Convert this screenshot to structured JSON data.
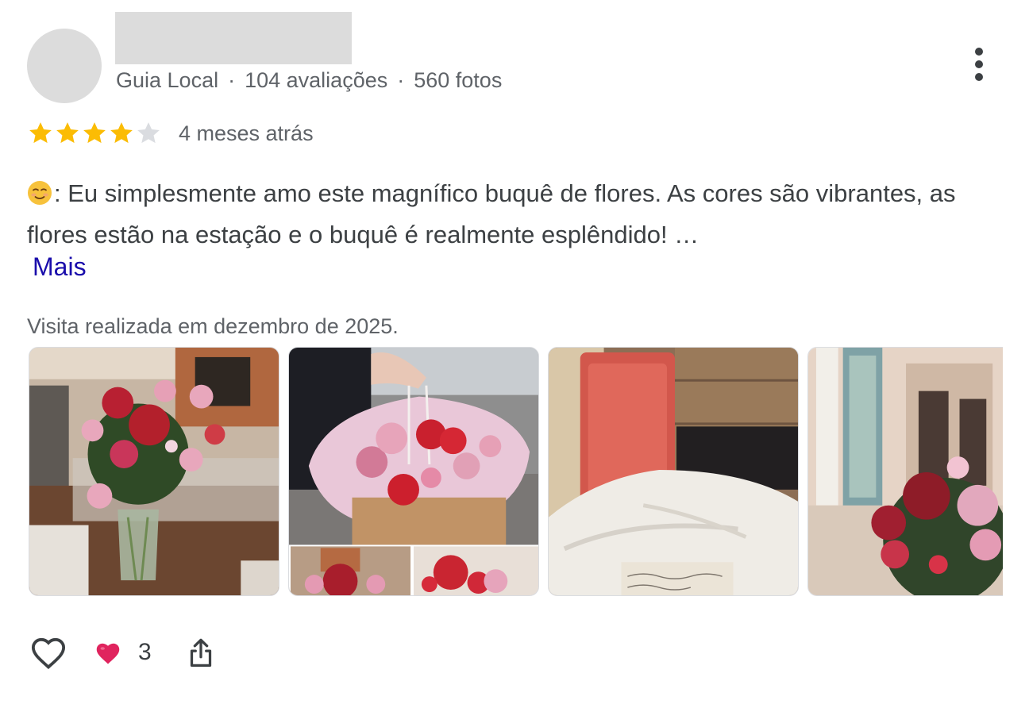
{
  "reviewer": {
    "badge": "Guia Local",
    "reviews": "104 avaliações",
    "photos": "560 fotos",
    "separator": "·"
  },
  "rating": {
    "value": 4,
    "max": 5,
    "time_ago": "4 meses atrás"
  },
  "review": {
    "text": ": Eu simplesmente amo este magnífico buquê de flores. As cores são vibrantes, as flores estão na estação e o buquê é realmente esplêndido! …",
    "more_label": "Mais"
  },
  "visit": {
    "label": "Visita realizada em dezembro de 2025."
  },
  "reactions": {
    "heart_count": "3"
  },
  "colors": {
    "star_filled": "#fbbc04",
    "star_empty": "#dadce0",
    "link": "#1a0dab",
    "reaction_heart": "#e0245e"
  },
  "icons": [
    "more-vert-icon",
    "star-icon",
    "smiling-face-emoji",
    "heart-outline-icon",
    "red-heart-emoji",
    "share-icon"
  ]
}
